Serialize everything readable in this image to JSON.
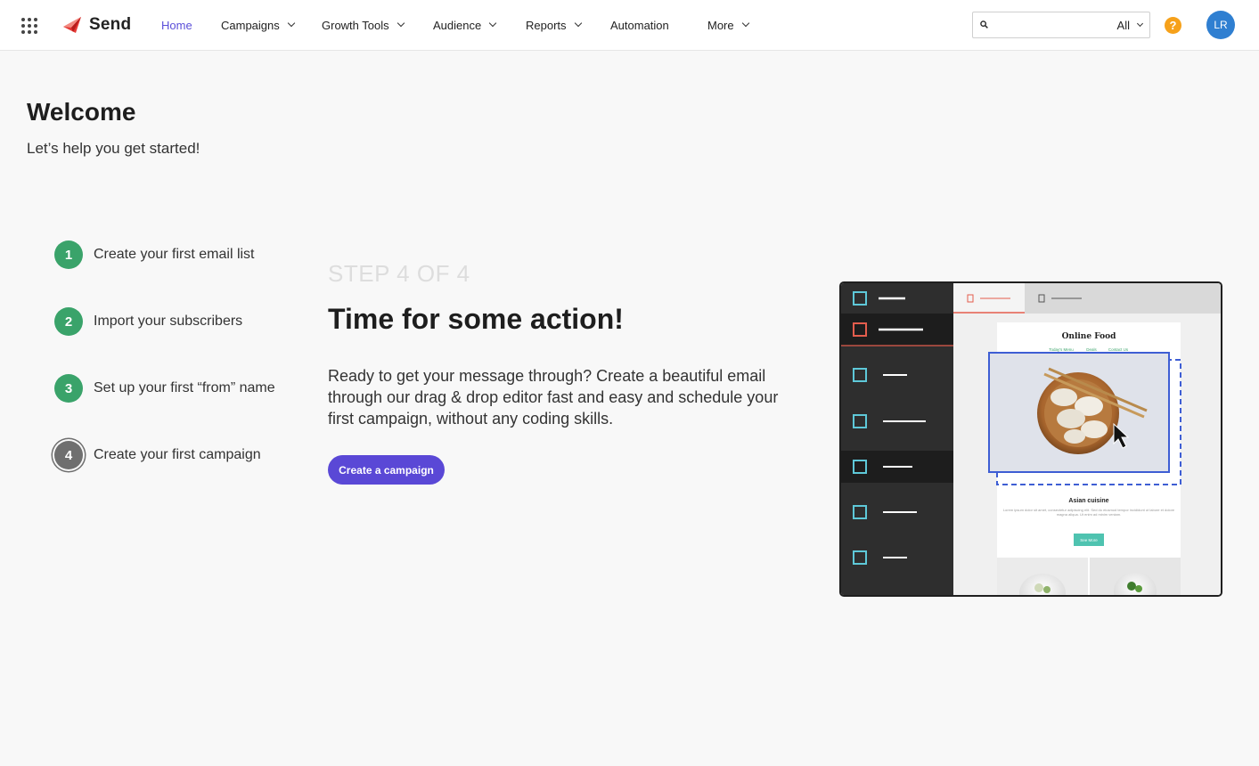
{
  "app": {
    "name": "Send"
  },
  "nav": {
    "home": "Home",
    "campaigns": "Campaigns",
    "growth_tools": "Growth Tools",
    "audience": "Audience",
    "reports": "Reports",
    "automation": "Automation",
    "more": "More"
  },
  "search": {
    "value": "",
    "placeholder": "",
    "scope": "All"
  },
  "help": {
    "glyph": "?"
  },
  "user": {
    "initials": "LR"
  },
  "welcome": {
    "title": "Welcome",
    "subtitle": "Let’s help you get started!"
  },
  "steps": [
    {
      "number": "1",
      "label": "Create your first email list",
      "status": "complete"
    },
    {
      "number": "2",
      "label": "Import your subscribers",
      "status": "complete"
    },
    {
      "number": "3",
      "label": "Set up your first “from” name",
      "status": "complete"
    },
    {
      "number": "4",
      "label": "Create your first campaign",
      "status": "current"
    }
  ],
  "current_step": {
    "counter": "STEP 4 OF 4",
    "title": "Time for some action!",
    "description": "Ready to get your message through? Create a beautiful email through our drag & drop editor fast and easy and schedule your first campaign, without any coding skills.",
    "cta": "Create a campaign"
  },
  "illustration": {
    "email_title": "Online Food",
    "email_links": [
      "Today's Menu",
      "Deals",
      "Contact Us"
    ],
    "section_title": "Asian cuisine",
    "body_text": "Lorem ipsum dolor sit amet, consectetur adipiscing elit. Sed do eiusmod tempor incididunt ut labore et dolore magna aliqua. Ut enim ad minim veniam.",
    "button": "See More"
  },
  "colors": {
    "accent": "#5a48d6",
    "active_nav": "#5b4fd9",
    "step_complete": "#3aa36a",
    "step_current": "#6f6f6f",
    "help": "#f6a11a",
    "avatar": "#2f7fd1",
    "brand_mark": "#e53935"
  }
}
